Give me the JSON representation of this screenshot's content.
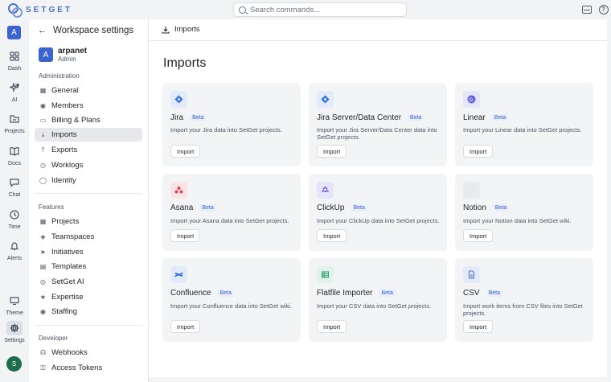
{
  "app": {
    "logo_text": "SETGET",
    "brand_color": "#3b63d1"
  },
  "search": {
    "placeholder": "Search commands..."
  },
  "rail": {
    "workspace_initial": "A",
    "items": [
      {
        "label": "Dash",
        "icon": "dashboard-icon"
      },
      {
        "label": "AI",
        "icon": "sparkle-icon"
      },
      {
        "label": "Projects",
        "icon": "folder-icon"
      },
      {
        "label": "Docs",
        "icon": "book-icon"
      },
      {
        "label": "Chat",
        "icon": "chat-icon"
      },
      {
        "label": "Time",
        "icon": "clock-icon"
      },
      {
        "label": "Alerts",
        "icon": "bell-icon"
      },
      {
        "label": "Theme",
        "icon": "monitor-icon"
      },
      {
        "label": "Settings",
        "icon": "gear-icon"
      }
    ],
    "user_initial": "S"
  },
  "settings": {
    "title": "Workspace settings",
    "workspace": {
      "initial": "A",
      "name": "arpanet",
      "role": "Admin"
    },
    "sections": [
      {
        "label": "Administration",
        "items": [
          "General",
          "Members",
          "Billing & Plans",
          "Imports",
          "Exports",
          "Worklogs",
          "Identity"
        ]
      },
      {
        "label": "Features",
        "items": [
          "Projects",
          "Teamspaces",
          "Initiatives",
          "Templates",
          "SetGet AI",
          "Expertise",
          "Staffing"
        ]
      },
      {
        "label": "Developer",
        "items": [
          "Webhooks",
          "Access Tokens"
        ]
      }
    ],
    "active_item": "Imports"
  },
  "main": {
    "breadcrumb": "Imports",
    "title": "Imports",
    "cards": [
      {
        "title": "Jira",
        "badge": "Beta",
        "description": "Import your Jira data into SetGet projects.",
        "button": "Import",
        "icon": "jira-icon",
        "icon_bg": "#e3ebfb",
        "icon_color": "#2f6fe0"
      },
      {
        "title": "Jira Server/Data Center",
        "badge": "Beta",
        "description": "Import your Jira Server/Data Center data into SetGet projects.",
        "button": "Import",
        "icon": "jira-server-icon",
        "icon_bg": "#e3ebfb",
        "icon_color": "#2f6fe0"
      },
      {
        "title": "Linear",
        "badge": "Beta",
        "description": "Import your Linear data into SetGet projects.",
        "button": "Import",
        "icon": "linear-icon",
        "icon_bg": "#e6e5fb",
        "icon_color": "#5b5bd6"
      },
      {
        "title": "Asana",
        "badge": "Beta",
        "description": "Import your Asana data into SetGet projects.",
        "button": "Import",
        "icon": "asana-icon",
        "icon_bg": "#fbe4e6",
        "icon_color": "#e2445c"
      },
      {
        "title": "ClickUp",
        "badge": "Beta",
        "description": "Import your ClickUp data into SetGet projects.",
        "button": "Import",
        "icon": "clickup-icon",
        "icon_bg": "#e6e5fb",
        "icon_color": "#6d5ce6"
      },
      {
        "title": "Notion",
        "badge": "Beta",
        "description": "Import your Notion data into SetGet wiki.",
        "button": "Import",
        "icon": "notion-icon",
        "icon_bg": "#e9eaec",
        "icon_color": "#e9eaec"
      },
      {
        "title": "Confluence",
        "badge": "Beta",
        "description": "Import your Confluence data into SetGet wiki.",
        "button": "Import",
        "icon": "confluence-icon",
        "icon_bg": "#e3ebfb",
        "icon_color": "#2f6fe0"
      },
      {
        "title": "Flatfile Importer",
        "badge": "Beta",
        "description": "Import your CSV data into SetGet projects.",
        "button": "Import",
        "icon": "table-icon",
        "icon_bg": "#dff3ea",
        "icon_color": "#2e9a66"
      },
      {
        "title": "CSV",
        "badge": "Beta",
        "description": "Import work items from CSV files into SetGet projects.",
        "button": "Import",
        "icon": "file-icon",
        "icon_bg": "#e3ebfb",
        "icon_color": "#4a72c9"
      }
    ]
  }
}
